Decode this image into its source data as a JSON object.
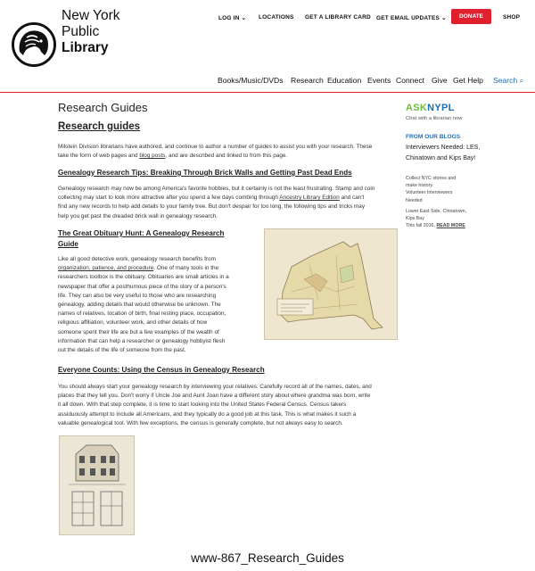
{
  "header": {
    "brand_line1": "New York",
    "brand_line2": "Public",
    "brand_line3": "Library",
    "top_links": [
      "LOG IN",
      "LOCATIONS",
      "GET A LIBRARY CARD",
      "GET EMAIL UPDATES",
      "SHOP"
    ],
    "donate_label": "DONATE",
    "main_nav": [
      "Books/Music/DVDs",
      "Research",
      "Education",
      "Events",
      "Connect",
      "Give",
      "Get Help",
      "Search"
    ]
  },
  "content": {
    "page_title": "Research Guides",
    "section_title": "Research guides",
    "intro_a": "Milstein Division librarians have authored, and continue to author a number of guides to assist you with your research. These",
    "intro_b": "take the form of web pages and ",
    "intro_link": "blog posts",
    "intro_c": ", and are described and linked to from this page.",
    "genealogy_heading": "Genealogy Research Tips: Breaking Through Brick Walls and Getting Past Dead Ends",
    "genealogy_lines": [
      "Genealogy research may now be among America's favorite hobbies, but it certainly is not the least frustrating. Stamp and coin",
      "collecting may start to look more attractive after you spend a few days combing through ",
      "find any new records to help add details to your family tree. But don't despair for too long, the following tips and tricks may",
      "help you get past the dreaded brick wall in genealogy research."
    ],
    "genealogy_link": "Ancestry Library Edition",
    "genealogy_after_link": " and can't",
    "obit_heading_1": "The Great Obituary Hunt: A Genealogy Research",
    "obit_heading_2": "Guide",
    "obit_line1": "Like all good detective work, genealogy research benefits from",
    "obit_link": "organization, patience, and procedure",
    "obit_line2_rest": ". One of many tools in the",
    "obit_lines": [
      "researchers toolbox is the obituary. Obituaries are small articles in a",
      "newspaper that offer a posthumous piece of the story of a person's",
      "life. They can also be very useful to those who are researching",
      "genealogy, adding details that would otherwise be unknown. The",
      "names of relatives, location of birth, final resting place, occupation,",
      "religious affiliation, volunteer work, and other details of how",
      "someone spent their life are but a few examples of the wealth of",
      "information that can help a researcher or genealogy hobbyist flesh",
      "out the details of the life of someone from the past."
    ],
    "census_heading": "Everyone Counts: Using the Census in Genealogy Research",
    "census_lines": [
      "You should always start your genealogy research by interviewing your relatives. Carefully record all of the names, dates, and",
      "places that they tell you. Don't worry if Uncle Joe and Aunt Joan have a different story about where grandma was born, write",
      "it all down. With that step complete, it is time to start looking into the United States Federal Census. Census takers",
      "assiduously attempt to include all Americans, and they typically do a good job at this task. This is what makes it such a",
      "valuable genealogical tool. With few exceptions, the census is generally complete, but not always easy to search."
    ]
  },
  "sidebar": {
    "ask_a": "ASK",
    "ask_b": "NYPL",
    "ask_sub": "Chat with a librarian now",
    "blogs_heading": "FROM OUR BLOGS",
    "blog_title": "Interviewers Needed: LES, Chinatown and Kips Bay!",
    "blog_lines": [
      "Collect NYC stories and",
      "make history.",
      "Volunteer Interviewers",
      "Needed"
    ],
    "blog_lines2": [
      "Lower East Side, Chinatown,",
      "Kips Bay",
      "This fall 2016, "
    ],
    "read_more": "READ MORE"
  },
  "caption": "www-867_Research_Guides",
  "colors": {
    "accent_red": "#d8232a",
    "link_blue": "#1e6fb8",
    "ask_green": "#6cbf3a"
  }
}
